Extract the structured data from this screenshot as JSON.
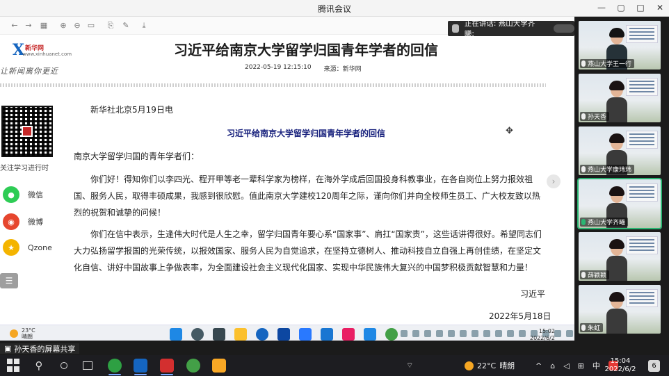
{
  "window": {
    "title": "腾讯会议",
    "controls": [
      "—",
      "▢",
      "□",
      "✕"
    ]
  },
  "speaking": {
    "label": "正在讲话: 燕山大学齐曦;"
  },
  "article": {
    "brand_top": "新华网",
    "brand_sub": "www.xinhuanet.com",
    "slogan": "让新闻离你更近",
    "title": "习近平给南京大学留学归国青年学者的回信",
    "datetime": "2022-05-19 12:15:10",
    "source": "来源：新华网",
    "dateline": "新华社北京5月19日电",
    "subtitle": "习近平给南京大学留学归国青年学者的回信",
    "salutation": "南京大学留学归国的青年学者们：",
    "paragraph1": "你们好！得知你们以李四光、程开甲等老一辈科学家为榜样，在海外学成后回国投身科教事业，在各自岗位上努力报效祖国、服务人民，取得丰硕成果，我感到很欣慰。值此南京大学建校120周年之际，谨向你们并向全校师生员工、广大校友致以热烈的祝贺和诚挚的问候！",
    "paragraph2": "你们在信中表示，生逢伟大时代是人生之幸，留学归国青年要心系“国家事”、肩扛“国家责”，这些话讲得很好。希望同志们大力弘扬留学报国的光荣传统，以报效国家、服务人民为自觉追求，在坚持立德树人、推动科技自立自强上再创佳绩，在坚定文化自信、讲好中国故事上争做表率，为全面建设社会主义现代化国家、实现中华民族伟大复兴的中国梦积极贡献智慧和力量！",
    "signature": "习近平",
    "date": "2022年5月18日"
  },
  "sidebar": {
    "follow_label": "关注学习进行时",
    "share": [
      {
        "label": "微信",
        "icon": "wechat-icon",
        "color": "#2ecc55",
        "glyph": "●"
      },
      {
        "label": "微博",
        "icon": "weibo-icon",
        "color": "#e6462e",
        "glyph": "◉"
      },
      {
        "label": "Qzone",
        "icon": "qzone-icon",
        "color": "#f4b400",
        "glyph": "★"
      }
    ],
    "menu_glyph": "☰"
  },
  "inner_taskbar": {
    "temp": "23°C",
    "weather": "晴朗",
    "time": "15:02",
    "date": "2022/6/2"
  },
  "sharer": {
    "label": "孙天香的屏幕共享"
  },
  "participants": [
    {
      "name": "燕山大学王一行",
      "gender": "m",
      "active": false
    },
    {
      "name": "孙天香",
      "gender": "f",
      "active": false
    },
    {
      "name": "燕山大学康玮玮",
      "gender": "f",
      "active": false
    },
    {
      "name": "燕山大学齐曦",
      "gender": "f",
      "active": true
    },
    {
      "name": "薛颖颖",
      "gender": "f",
      "active": false
    },
    {
      "name": "朱虹",
      "gender": "f",
      "active": false
    }
  ],
  "taskbar": {
    "temp": "22°C",
    "weather": "晴朗",
    "ime": "中",
    "time": "15:04",
    "date": "2022/6/2",
    "notifications": "6",
    "tray_glyphs": [
      "^",
      "⌂",
      "◁",
      "⊞"
    ]
  },
  "colors": {
    "accent_green": "#2bb673",
    "title_blue": "#1a237e"
  }
}
